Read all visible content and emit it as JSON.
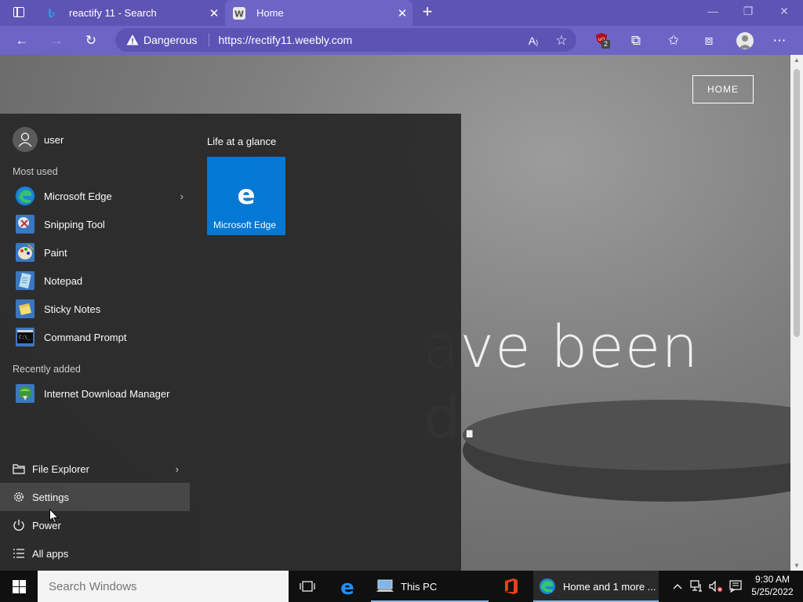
{
  "browser": {
    "tabs": [
      {
        "title": "reactify 11 - Search"
      },
      {
        "title": "Home"
      }
    ],
    "address": {
      "security_label": "Dangerous",
      "url": "https://rectify11.weebly.com"
    },
    "extension_badge": "2"
  },
  "page": {
    "home_button": "HOME",
    "headline_line1": "ave been",
    "headline_line2": "d."
  },
  "start_menu": {
    "user": "user",
    "most_used_label": "Most used",
    "most_used": [
      {
        "label": "Microsoft Edge",
        "icon": "edge-icon"
      },
      {
        "label": "Snipping Tool",
        "icon": "snipping-tool-icon"
      },
      {
        "label": "Paint",
        "icon": "paint-icon"
      },
      {
        "label": "Notepad",
        "icon": "notepad-icon"
      },
      {
        "label": "Sticky Notes",
        "icon": "sticky-notes-icon"
      },
      {
        "label": "Command Prompt",
        "icon": "command-prompt-icon"
      }
    ],
    "recently_added_label": "Recently added",
    "recently_added": [
      {
        "label": "Internet Download Manager",
        "icon": "idm-icon"
      }
    ],
    "bottom": [
      {
        "label": "File Explorer",
        "icon": "file-explorer-icon"
      },
      {
        "label": "Settings",
        "icon": "gear-icon"
      },
      {
        "label": "Power",
        "icon": "power-icon"
      },
      {
        "label": "All apps",
        "icon": "list-icon"
      }
    ],
    "tiles_group": "Life at a glance",
    "tiles": [
      {
        "label": "Microsoft Edge",
        "color": "#0078d7"
      }
    ]
  },
  "taskbar": {
    "search_placeholder": "Search Windows",
    "this_pc_label": "This PC",
    "edge_window_label": "Home and 1 more ...",
    "time": "9:30 AM",
    "date": "5/25/2022"
  },
  "colors": {
    "browser_accent": "#6d64c6",
    "tile_blue": "#0078d7",
    "warning_red": "#c42b1c"
  }
}
